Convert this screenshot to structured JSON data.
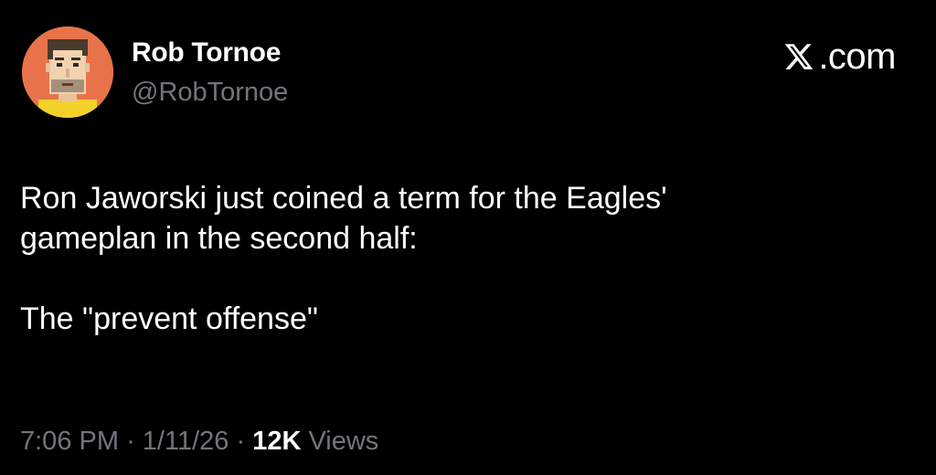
{
  "author": {
    "display_name": "Rob Tornoe",
    "handle": "@RobTornoe",
    "avatar_icon": "pixel-art-portrait-avatar"
  },
  "brand": {
    "logo_icon": "x-logo-icon",
    "label": ".com"
  },
  "tweet": {
    "paragraph_1": "Ron Jaworski just coined a term for the Eagles'\ngameplan in the second half:",
    "paragraph_2": "The \"prevent offense\""
  },
  "meta": {
    "time": "7:06 PM",
    "separator": "·",
    "date": "1/11/26",
    "views_count": "12K",
    "views_label": "Views"
  },
  "colors": {
    "background": "#000000",
    "primary_text": "#ffffff",
    "secondary_text": "#71767b",
    "avatar_background": "#e8734a"
  }
}
